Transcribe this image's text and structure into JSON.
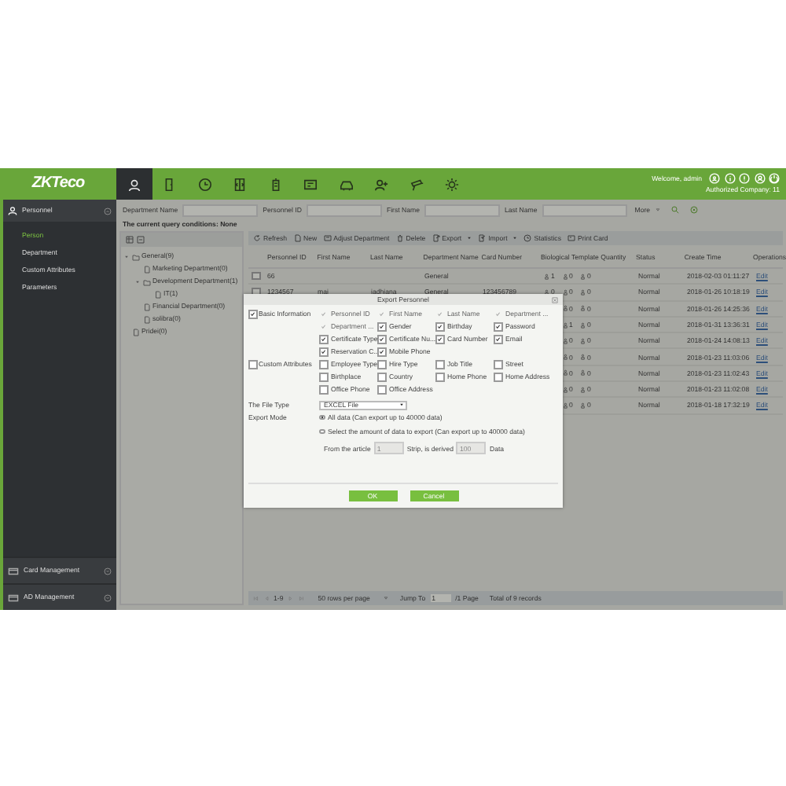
{
  "header": {
    "logo": "ZKTeco",
    "modules": [
      {
        "selected": true
      },
      {
        "selected": false
      },
      {
        "selected": false
      },
      {
        "selected": false
      },
      {
        "selected": false
      },
      {
        "selected": false
      },
      {
        "selected": false
      },
      {
        "selected": false
      },
      {
        "selected": false
      },
      {
        "selected": false
      }
    ],
    "welcome": "Welcome, admin",
    "company": "Authorized Company: 11"
  },
  "sidebar": {
    "section": "Personnel",
    "items": [
      {
        "label": "Person",
        "selected": true
      },
      {
        "label": "Department",
        "selected": false
      },
      {
        "label": "Custom Attributes",
        "selected": false
      },
      {
        "label": "Parameters",
        "selected": false
      }
    ],
    "bottom_sections": [
      "Card Management",
      "AD Management"
    ]
  },
  "search": {
    "fields": [
      {
        "label": "Department Name"
      },
      {
        "label": "Personnel ID"
      },
      {
        "label": "First Name"
      },
      {
        "label": "Last Name"
      }
    ],
    "more": "More"
  },
  "query": "The current query conditions: None",
  "tree": [
    {
      "label": "General(9)",
      "expanded": true,
      "children": [
        {
          "label": "Marketing Department(0)"
        },
        {
          "label": "Development Department(1)",
          "expanded": true,
          "children": [
            {
              "label": "IT(1)"
            }
          ]
        },
        {
          "label": "Financial Department(0)"
        },
        {
          "label": "solibra(0)"
        }
      ]
    },
    {
      "label": "Pridei(0)"
    }
  ],
  "toolbar": [
    {
      "label": "Refresh",
      "menu": false
    },
    {
      "label": "New",
      "menu": false
    },
    {
      "label": "Adjust Department",
      "menu": false
    },
    {
      "label": "Delete",
      "menu": false
    },
    {
      "label": "Export",
      "menu": true
    },
    {
      "label": "Import",
      "menu": true
    },
    {
      "label": "Statistics",
      "menu": false
    },
    {
      "label": "Print Card",
      "menu": false
    }
  ],
  "table": {
    "columns": [
      "Personnel ID",
      "First Name",
      "Last Name",
      "Department Name",
      "Card Number",
      "Biological Template Quantity",
      "Status",
      "Create Time",
      "Operations"
    ],
    "rows": [
      {
        "checked": false,
        "personnel_id": "66",
        "department": "General",
        "bio": [
          "1",
          "0",
          "0"
        ],
        "status": "Normal",
        "create_time": "2018-02-03 01:11:27",
        "operation": "Edit"
      },
      {
        "checked": false,
        "personnel_id": "1234567",
        "first_name": "mai",
        "last_name": "jadhiana",
        "department": "General",
        "card_number": "123456789",
        "bio": [
          "0",
          "0",
          "0"
        ],
        "status": "Normal",
        "create_time": "2018-01-26 10:18:19",
        "operation": "Edit"
      },
      {
        "bio": [
          "0",
          "0"
        ],
        "status": "Normal",
        "create_time": "2018-01-26 14:25:36",
        "operation": "Edit"
      },
      {
        "bio": [
          "1",
          "0"
        ],
        "status": "Normal",
        "create_time": "2018-01-31 13:36:31",
        "operation": "Edit"
      },
      {
        "bio": [
          "0",
          "0"
        ],
        "status": "Normal",
        "create_time": "2018-01-24 14:08:13",
        "operation": "Edit"
      },
      {
        "bio": [
          "0",
          "0"
        ],
        "status": "Normal",
        "create_time": "2018-01-23 11:03:06",
        "operation": "Edit"
      },
      {
        "bio": [
          "0",
          "0"
        ],
        "status": "Normal",
        "create_time": "2018-01-23 11:02:43",
        "operation": "Edit"
      },
      {
        "bio": [
          "0",
          "0"
        ],
        "status": "Normal",
        "create_time": "2018-01-23 11:02:08",
        "operation": "Edit"
      },
      {
        "bio": [
          "0",
          "0"
        ],
        "status": "Normal",
        "create_time": "2018-01-18 17:32:19",
        "operation": "Edit"
      }
    ]
  },
  "pager": {
    "range": "1-9",
    "page_size": "50 rows per page",
    "jump_label": "Jump To",
    "page": "1",
    "pages": "/1 Page",
    "total": "Total of 9 records"
  },
  "dialog": {
    "title": "Export Personnel",
    "groups": [
      {
        "label": "Basic Information",
        "checked": true,
        "fields": [
          {
            "label": "Personnel ID",
            "checked": true,
            "disabled": true
          },
          {
            "label": "First Name",
            "checked": true,
            "disabled": true
          },
          {
            "label": "Last Name",
            "checked": true,
            "disabled": true
          },
          {
            "label": "Department ...",
            "checked": true,
            "disabled": true
          },
          {
            "label": "Department ...",
            "checked": true,
            "disabled": true
          },
          {
            "label": "Gender",
            "checked": true,
            "disabled": false
          },
          {
            "label": "Birthday",
            "checked": true,
            "disabled": false
          },
          {
            "label": "Password",
            "checked": true,
            "disabled": false
          },
          {
            "label": "Certificate Type",
            "checked": true,
            "disabled": false
          },
          {
            "label": "Certificate Nu...",
            "checked": true,
            "disabled": false
          },
          {
            "label": "Card Number",
            "checked": true,
            "disabled": false
          },
          {
            "label": "Email",
            "checked": true,
            "disabled": false
          },
          {
            "label": "Reservation C...",
            "checked": true,
            "disabled": false
          },
          {
            "label": "Mobile Phone",
            "checked": true,
            "disabled": false
          }
        ]
      },
      {
        "label": "Custom Attributes",
        "checked": false,
        "fields": [
          {
            "label": "Employee Type",
            "checked": false,
            "disabled": false
          },
          {
            "label": "Hire Type",
            "checked": false,
            "disabled": false
          },
          {
            "label": "Job Title",
            "checked": false,
            "disabled": false
          },
          {
            "label": "Street",
            "checked": false,
            "disabled": false
          },
          {
            "label": "Birthplace",
            "checked": false,
            "disabled": false
          },
          {
            "label": "Country",
            "checked": false,
            "disabled": false
          },
          {
            "label": "Home Phone",
            "checked": false,
            "disabled": false
          },
          {
            "label": "Home Address",
            "checked": false,
            "disabled": false
          },
          {
            "label": "Office Phone",
            "checked": false,
            "disabled": false
          },
          {
            "label": "Office Address",
            "checked": false,
            "disabled": false
          }
        ]
      }
    ],
    "file_type_label": "The File Type",
    "file_type": "EXCEL File",
    "export_mode_label": "Export Mode",
    "modes": [
      {
        "label": "All data (Can export up to 40000 data)",
        "selected": true
      },
      {
        "label": "Select the amount of data to export (Can export up to 40000 data)",
        "selected": false
      }
    ],
    "range": {
      "from_label": "From the article",
      "from": "1",
      "mid_label": "Strip, is derived",
      "count": "100",
      "end_label": "Data"
    },
    "buttons": [
      "OK",
      "Cancel"
    ]
  }
}
